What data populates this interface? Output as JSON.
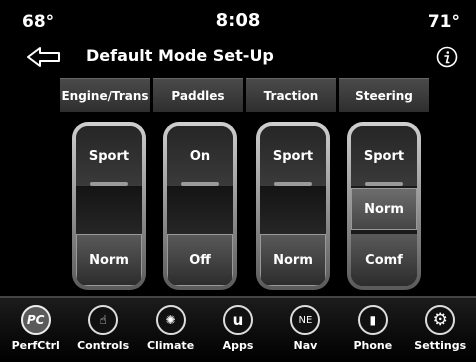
{
  "status": {
    "temp_left": "68°",
    "time": "8:08",
    "temp_right": "71°"
  },
  "header": {
    "title": "Default Mode Set-Up",
    "back_icon": "back-arrow-icon",
    "info_icon": "info-icon"
  },
  "tabs": [
    {
      "label": "Engine/Trans"
    },
    {
      "label": "Paddles"
    },
    {
      "label": "Traction"
    },
    {
      "label": "Steering"
    }
  ],
  "switches": [
    {
      "top": "Sport",
      "bottom": "Norm",
      "selected": "bottom"
    },
    {
      "top": "On",
      "bottom": "Off",
      "selected": "bottom"
    },
    {
      "top": "Sport",
      "bottom": "Norm",
      "selected": "bottom"
    },
    {
      "top": "Sport",
      "middle": "Norm",
      "bottom": "Comf",
      "selected": "middle"
    }
  ],
  "bottom_nav": [
    {
      "label": "PerfCtrl",
      "icon": "perf-control-icon",
      "icon_text": "PC",
      "active": true
    },
    {
      "label": "Controls",
      "icon": "hand-controls-icon",
      "icon_text": "☝",
      "active": false
    },
    {
      "label": "Climate",
      "icon": "climate-fan-icon",
      "icon_text": "✺",
      "active": false
    },
    {
      "label": "Apps",
      "icon": "apps-u-icon",
      "icon_text": "u",
      "active": false
    },
    {
      "label": "Nav",
      "icon": "compass-nav-icon",
      "icon_text": "NE",
      "active": false
    },
    {
      "label": "Phone",
      "icon": "phone-signal-icon",
      "icon_text": "▮",
      "active": false
    },
    {
      "label": "Settings",
      "icon": "gear-icon",
      "icon_text": "⚙",
      "active": false
    }
  ]
}
